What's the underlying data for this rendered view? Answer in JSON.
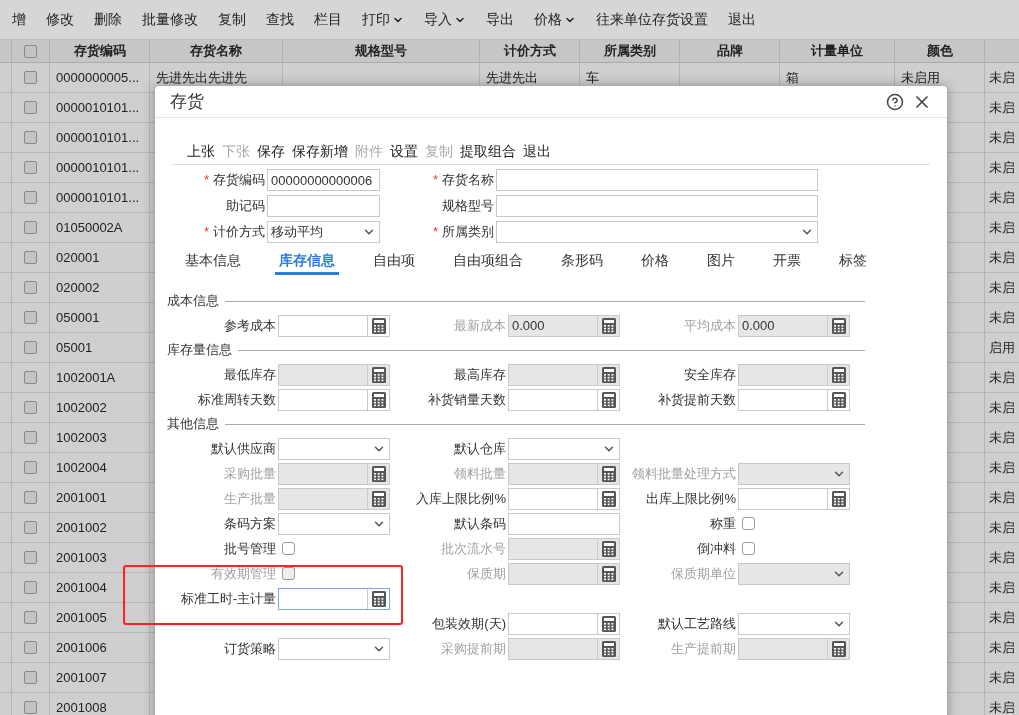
{
  "toolbar": [
    {
      "label": "增",
      "dropdown": false
    },
    {
      "label": "修改",
      "dropdown": false
    },
    {
      "label": "删除",
      "dropdown": false
    },
    {
      "label": "批量修改",
      "dropdown": false
    },
    {
      "label": "复制",
      "dropdown": false
    },
    {
      "label": "查找",
      "dropdown": false
    },
    {
      "label": "栏目",
      "dropdown": false
    },
    {
      "label": "打印",
      "dropdown": true
    },
    {
      "label": "导入",
      "dropdown": true
    },
    {
      "label": "导出",
      "dropdown": false
    },
    {
      "label": "价格",
      "dropdown": true
    },
    {
      "label": "往来单位存货设置",
      "dropdown": false
    },
    {
      "label": "退出",
      "dropdown": false
    }
  ],
  "table": {
    "select_all": false,
    "columns": [
      "存货编码",
      "存货名称",
      "规格型号",
      "计价方式",
      "所属类别",
      "品牌",
      "计量单位",
      "颜色"
    ],
    "rows": [
      {
        "checked": false,
        "code": "0000000005...",
        "name": "先进先出先进先",
        "pricing": "先进先出",
        "category": "车",
        "unit": "箱",
        "shade": "未启用",
        "status": "未启"
      },
      {
        "checked": false,
        "code": "0000010101...",
        "status": "未启"
      },
      {
        "checked": false,
        "code": "0000010101...",
        "status": "未启"
      },
      {
        "checked": false,
        "code": "0000010101...",
        "status": "未启"
      },
      {
        "checked": false,
        "code": "0000010101...",
        "status": "未启"
      },
      {
        "checked": false,
        "code": "01050002A",
        "status": "未启"
      },
      {
        "checked": false,
        "code": "020001",
        "status": "未启"
      },
      {
        "checked": false,
        "code": "020002",
        "status": "未启"
      },
      {
        "checked": false,
        "code": "050001",
        "status": "未启"
      },
      {
        "checked": false,
        "code": "05001",
        "status": "启用"
      },
      {
        "checked": false,
        "code": "1002001A",
        "status": "未启"
      },
      {
        "checked": false,
        "code": "1002002",
        "status": "未启"
      },
      {
        "checked": false,
        "code": "1002003",
        "status": "未启"
      },
      {
        "checked": false,
        "code": "1002004",
        "status": "未启"
      },
      {
        "checked": false,
        "code": "2001001",
        "status": "未启"
      },
      {
        "checked": false,
        "code": "2001002",
        "status": "未启"
      },
      {
        "checked": false,
        "code": "2001003",
        "status": "未启"
      },
      {
        "checked": false,
        "code": "2001004",
        "status": "未启"
      },
      {
        "checked": false,
        "code": "2001005",
        "status": "未启"
      },
      {
        "checked": false,
        "code": "2001006",
        "status": "未启"
      },
      {
        "checked": false,
        "code": "2001007",
        "status": "未启"
      },
      {
        "checked": false,
        "code": "2001008",
        "status": "未启"
      }
    ]
  },
  "dialog": {
    "title": "存货",
    "actions": [
      {
        "label": "上张",
        "disabled": false
      },
      {
        "label": "下张",
        "disabled": true
      },
      {
        "label": "保存",
        "disabled": false
      },
      {
        "label": "保存新增",
        "disabled": false
      },
      {
        "label": "附件",
        "disabled": true
      },
      {
        "label": "设置",
        "disabled": false
      },
      {
        "label": "复制",
        "disabled": true
      },
      {
        "label": "提取组合",
        "disabled": false
      },
      {
        "label": "退出",
        "disabled": false
      }
    ],
    "header_fields": [
      [
        {
          "marker": "*",
          "label": "存货编码",
          "kind": "text",
          "value": "00000000000006"
        },
        {
          "marker": "*",
          "label": "存货名称",
          "kind": "text"
        }
      ],
      [
        {
          "label": "助记码",
          "kind": "text"
        },
        {
          "label": "规格型号",
          "kind": "text"
        }
      ],
      [
        {
          "marker": "*",
          "label": "计价方式",
          "kind": "select",
          "value": "移动平均"
        },
        {
          "marker": "*",
          "label": "所属类别",
          "kind": "select"
        }
      ]
    ],
    "tabs": [
      {
        "label": "基本信息",
        "selected": false
      },
      {
        "label": "库存信息",
        "selected": true
      },
      {
        "label": "自由项",
        "selected": false
      },
      {
        "label": "自由项组合",
        "selected": false
      },
      {
        "label": "条形码",
        "selected": false
      },
      {
        "label": "价格",
        "selected": false
      },
      {
        "label": "图片",
        "selected": false
      },
      {
        "label": "开票",
        "selected": false
      },
      {
        "label": "标签",
        "selected": false
      }
    ],
    "sections": [
      {
        "title": "成本信息",
        "rows": [
          [
            {
              "label": "参考成本",
              "kind": "number",
              "disabled": false,
              "muted": false
            },
            {
              "label": "最新成本",
              "kind": "number",
              "disabled": true,
              "muted": true,
              "value": "0.000"
            },
            {
              "label": "平均成本",
              "kind": "number",
              "disabled": true,
              "muted": true,
              "value": "0.000"
            }
          ]
        ]
      },
      {
        "title": "库存量信息",
        "rows": [
          [
            {
              "label": "最低库存",
              "kind": "number",
              "disabled": true,
              "muted": false
            },
            {
              "label": "最高库存",
              "kind": "number",
              "disabled": true,
              "muted": false
            },
            {
              "label": "安全库存",
              "kind": "number",
              "disabled": true,
              "muted": false
            }
          ],
          [
            {
              "label": "标准周转天数",
              "kind": "number",
              "disabled": false,
              "muted": false
            },
            {
              "label": "补货销量天数",
              "kind": "number",
              "disabled": false,
              "muted": false
            },
            {
              "label": "补货提前天数",
              "kind": "number",
              "disabled": false,
              "muted": false
            }
          ]
        ]
      },
      {
        "title": "其他信息",
        "rows": [
          [
            {
              "label": "默认供应商",
              "kind": "select",
              "disabled": false,
              "muted": false
            },
            {
              "label": "默认仓库",
              "kind": "select",
              "disabled": false,
              "muted": false
            },
            null
          ],
          [
            {
              "label": "采购批量",
              "kind": "number",
              "disabled": true,
              "muted": true
            },
            {
              "label": "领料批量",
              "kind": "number",
              "disabled": true,
              "muted": true
            },
            {
              "label": "领料批量处理方式",
              "kind": "select",
              "disabled": true,
              "muted": true
            }
          ],
          [
            {
              "label": "生产批量",
              "kind": "number",
              "disabled": true,
              "muted": true
            },
            {
              "label": "入库上限比例%",
              "kind": "number",
              "disabled": false,
              "muted": false
            },
            {
              "label": "出库上限比例%",
              "kind": "number",
              "disabled": false,
              "muted": false
            }
          ],
          [
            {
              "label": "条码方案",
              "kind": "select",
              "disabled": false,
              "muted": false
            },
            {
              "label": "默认条码",
              "kind": "text",
              "disabled": false,
              "muted": false
            },
            {
              "label": "称重",
              "kind": "checkbox",
              "checked": false,
              "disabled": false,
              "muted": false
            }
          ],
          [
            {
              "label": "批号管理",
              "kind": "checkbox",
              "checked": false,
              "disabled": false,
              "muted": false
            },
            {
              "label": "批次流水号",
              "kind": "number",
              "disabled": true,
              "muted": true
            },
            {
              "label": "倒冲料",
              "kind": "checkbox",
              "checked": false,
              "disabled": false,
              "muted": false
            }
          ],
          [
            {
              "label": "有效期管理",
              "kind": "checkbox",
              "checked": false,
              "disabled": true,
              "muted": true
            },
            {
              "label": "保质期",
              "kind": "number",
              "disabled": true,
              "muted": true
            },
            {
              "label": "保质期单位",
              "kind": "select",
              "disabled": true,
              "muted": true
            }
          ],
          [
            {
              "label": "标准工时-主计量",
              "kind": "number",
              "disabled": false,
              "muted": false,
              "focused": true
            },
            null,
            null
          ],
          [
            null,
            {
              "label": "包装效期(天)",
              "kind": "number",
              "disabled": false,
              "muted": false
            },
            {
              "label": "默认工艺路线",
              "kind": "select",
              "disabled": false,
              "muted": false
            }
          ],
          [
            {
              "label": "订货策略",
              "kind": "select",
              "disabled": false,
              "muted": false
            },
            {
              "label": "采购提前期",
              "kind": "number",
              "disabled": true,
              "muted": true
            },
            {
              "label": "生产提前期",
              "kind": "number",
              "disabled": true,
              "muted": true
            }
          ]
        ]
      }
    ],
    "highlight_box": true
  }
}
